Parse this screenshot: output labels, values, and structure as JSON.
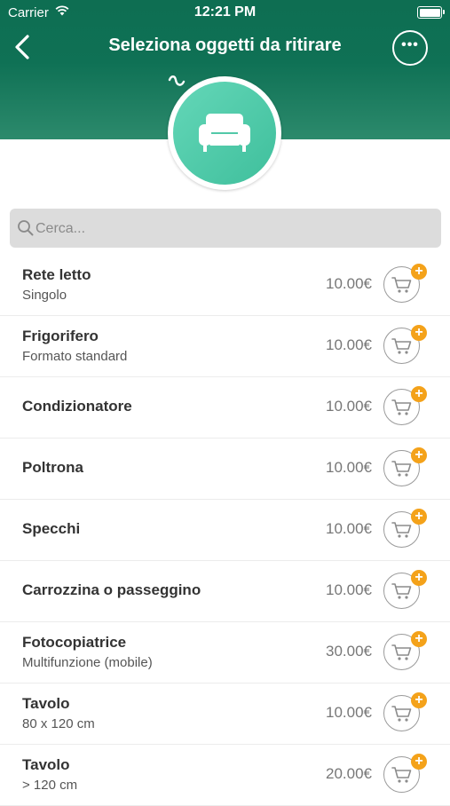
{
  "status_bar": {
    "carrier": "Carrier",
    "time": "12:21 PM"
  },
  "header": {
    "title": "Seleziona oggetti da ritirare"
  },
  "colors": {
    "header": "#0f7155",
    "badge": "#4fcaa8",
    "add_badge": "#f4a21a"
  },
  "category_icon": "sofa-icon",
  "search": {
    "placeholder": "Cerca...",
    "value": ""
  },
  "items": [
    {
      "name": "Rete letto",
      "detail": "Singolo",
      "price": "10.00€"
    },
    {
      "name": "Frigorifero",
      "detail": "Formato standard",
      "price": "10.00€"
    },
    {
      "name": "Condizionatore",
      "detail": "",
      "price": "10.00€"
    },
    {
      "name": "Poltrona",
      "detail": "",
      "price": "10.00€"
    },
    {
      "name": "Specchi",
      "detail": "",
      "price": "10.00€"
    },
    {
      "name": "Carrozzina o passeggino",
      "detail": "",
      "price": "10.00€"
    },
    {
      "name": "Fotocopiatrice",
      "detail": "Multifunzione (mobile)",
      "price": "30.00€"
    },
    {
      "name": "Tavolo",
      "detail": "80 x 120 cm",
      "price": "10.00€"
    },
    {
      "name": "Tavolo",
      "detail": "> 120 cm",
      "price": "20.00€"
    }
  ]
}
